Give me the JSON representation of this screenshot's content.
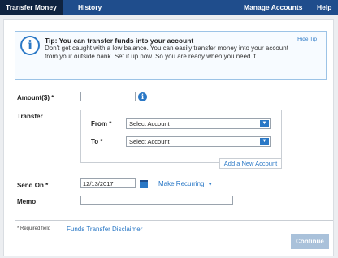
{
  "nav": {
    "transfer_money": "Transfer Money",
    "history": "History",
    "manage_accounts": "Manage Accounts",
    "help": "Help"
  },
  "tip": {
    "title": "Tip: You can transfer funds into your account",
    "text": "Don't get caught with a low balance. You can easily transfer money into your account from your outside bank. Set it up now. So you are ready when you need it.",
    "hide": "Hide Tip"
  },
  "form": {
    "amount_label": "Amount($) *",
    "amount_value": "",
    "transfer_label": "Transfer",
    "from_label": "From *",
    "from_value": "Select Account",
    "to_label": "To *",
    "to_value": "Select Account",
    "add_account": "Add a New Account",
    "send_on_label": "Send On *",
    "send_on_value": "12/13/2017",
    "make_recurring": "Make Recurring",
    "memo_label": "Memo",
    "memo_value": ""
  },
  "footer": {
    "required": "* Required field",
    "disclaimer": "Funds Transfer Disclaimer",
    "continue": "Continue"
  },
  "colors": {
    "nav_bg": "#1f4d8c",
    "nav_active": "#0f2340",
    "accent": "#2a78c6",
    "continue_disabled": "#a9c1da"
  },
  "icons": {
    "info": "info-icon",
    "calendar": "calendar-icon",
    "dropdown": "chevron-down-icon"
  }
}
